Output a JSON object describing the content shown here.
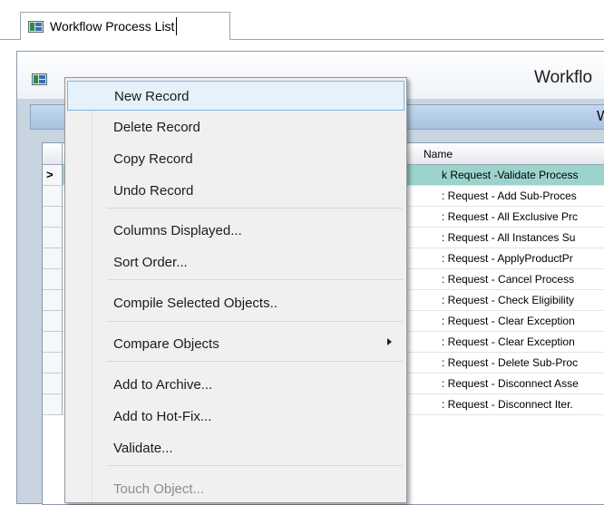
{
  "tab": {
    "label": "Workflow Process List"
  },
  "window": {
    "title": "Workflo",
    "subtitle": "Wo"
  },
  "grid": {
    "name_header": "Name",
    "rows": [
      "k Request -Validate Process",
      ": Request - Add Sub-Proces",
      ": Request - All Exclusive Prc",
      ": Request - All Instances Su",
      ": Request - ApplyProductPr",
      ": Request - Cancel Process",
      ": Request - Check Eligibility",
      ": Request - Clear Exception",
      ": Request - Clear Exception",
      ": Request - Delete Sub-Proc",
      ": Request - Disconnect Asse",
      ": Request - Disconnect Iter."
    ],
    "current_row_marker": ">"
  },
  "menu": {
    "items": [
      {
        "label": "New Record"
      },
      {
        "label": "Delete Record"
      },
      {
        "label": "Copy Record"
      },
      {
        "label": "Undo Record"
      },
      {
        "label": "Columns Displayed..."
      },
      {
        "label": "Sort Order..."
      },
      {
        "label": "Compile Selected Objects.."
      },
      {
        "label": "Compare Objects"
      },
      {
        "label": "Add to Archive..."
      },
      {
        "label": "Add to Hot-Fix..."
      },
      {
        "label": "Validate..."
      },
      {
        "label": "Touch Object..."
      }
    ]
  },
  "colors": {
    "selected_row": "#9bd4cc",
    "menu_highlight": "#e5f1fb",
    "menu_highlight_border": "#7cb4e8",
    "subheader": "#b8cfe8"
  }
}
